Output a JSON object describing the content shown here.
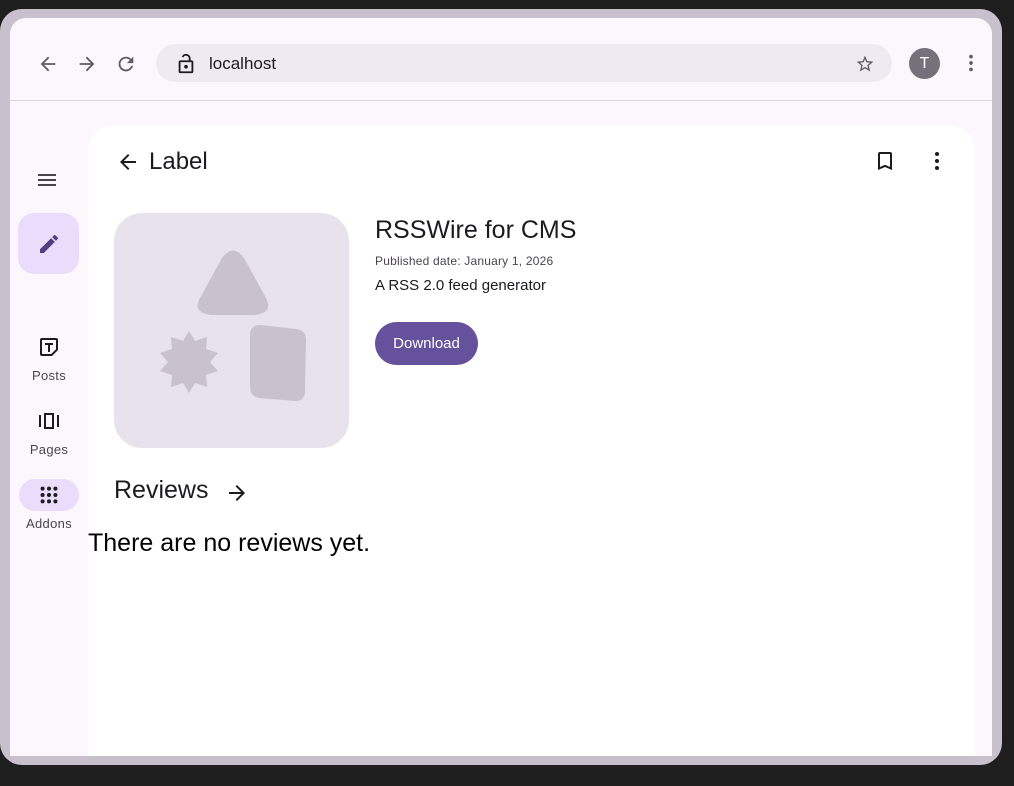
{
  "browser": {
    "url": "localhost",
    "profile_initial": "T"
  },
  "rail": {
    "items": [
      {
        "label": "Posts",
        "icon": "text-post-icon"
      },
      {
        "label": "Pages",
        "icon": "pages-carousel-icon"
      },
      {
        "label": "Addons",
        "icon": "apps-grid-icon",
        "active": true
      }
    ]
  },
  "top_bar": {
    "title": "Label"
  },
  "addon": {
    "title": "RSSWire for CMS",
    "published": "Published date: January 1, 2026",
    "description": "A RSS 2.0 feed generator",
    "download_label": "Download"
  },
  "reviews": {
    "heading": "Reviews",
    "empty_text": "There are no reviews yet."
  },
  "colors": {
    "primary": "#65519c",
    "secondary_container": "#e9ddfb",
    "surface": "#fcf7fd",
    "placeholder": "#e8e2ec",
    "placeholder_shapes": "#c9c2cd"
  }
}
